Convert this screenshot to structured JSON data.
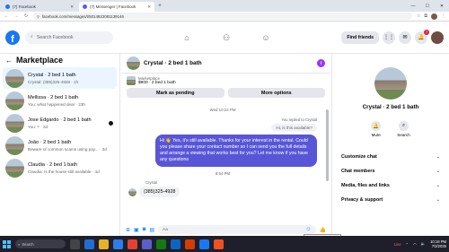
{
  "browser": {
    "tabs": [
      {
        "label": "(7) Facebook",
        "active": false
      },
      {
        "label": "(7) Messenger | Facebook",
        "active": true
      }
    ],
    "new_tab": "+",
    "url": "facebook.com/messages/t/5014922081139146",
    "window_controls": [
      "—",
      "☐",
      "✕"
    ]
  },
  "header": {
    "logo": "f",
    "search_placeholder": "Search Facebook",
    "find_friends": "Find friends",
    "notifications_badge": "7"
  },
  "marketplace": {
    "title": "Marketplace",
    "conversations": [
      {
        "name": "Crystal · 2 bed 1 bath",
        "preview": "Crystal: (385)325-4928 · 1h",
        "selected": true,
        "dot": false
      },
      {
        "name": "Mellissa · 2 bed 1 bath",
        "preview": "You: what happened dear · 23h",
        "selected": false,
        "dot": false
      },
      {
        "name": "Jose Edgardo · 2 bed 1 bath",
        "preview": "You: ? · 2d",
        "selected": false,
        "dot": true
      },
      {
        "name": "João · 2 bed 1 bath",
        "preview": "Beware of common scams using pay... · 3d",
        "selected": false,
        "dot": false
      },
      {
        "name": "Claudia · 2 bed 1 bath",
        "preview": "Claudia: Is the house still available · 4d",
        "selected": false,
        "dot": false
      }
    ]
  },
  "chat": {
    "title": "Crystal · 2 bed 1 bath",
    "info_icon": "i",
    "listing": {
      "source": "Marketplace",
      "price_line": "$900 · 2 bed 1 bath",
      "mark_pending": "Mark as pending",
      "more_options": "More options"
    },
    "timestamp1": "Wed 10:24 PM",
    "replied_label": "You replied to Crystal",
    "quoted": "Hi, is this available?",
    "outgoing": "Hi 👋 Yes, it's still available. Thanks for your interest in the rental. Could you please share your contact number so I can send you the full details and arrange a viewing that works best for you? Let me know if you have any questions",
    "timestamp2": "8:54 PM",
    "sender": "Crystal",
    "incoming": "(385)325-4928",
    "composer_placeholder": "Aa"
  },
  "info_panel": {
    "name": "Crystal · 2 bed 1 bath",
    "actions": [
      {
        "label": "Mute",
        "icon": "bell-icon"
      },
      {
        "label": "Search",
        "icon": "search-icon"
      }
    ],
    "sections": [
      "Customize chat",
      "Chat members",
      "Media, files and links",
      "Privacy & support"
    ]
  },
  "tooltip": "Person 42 - Chrome",
  "taskbar": {
    "search": "Search",
    "live": "Live",
    "time": "10:18 PM",
    "date": "7/3/2025"
  }
}
